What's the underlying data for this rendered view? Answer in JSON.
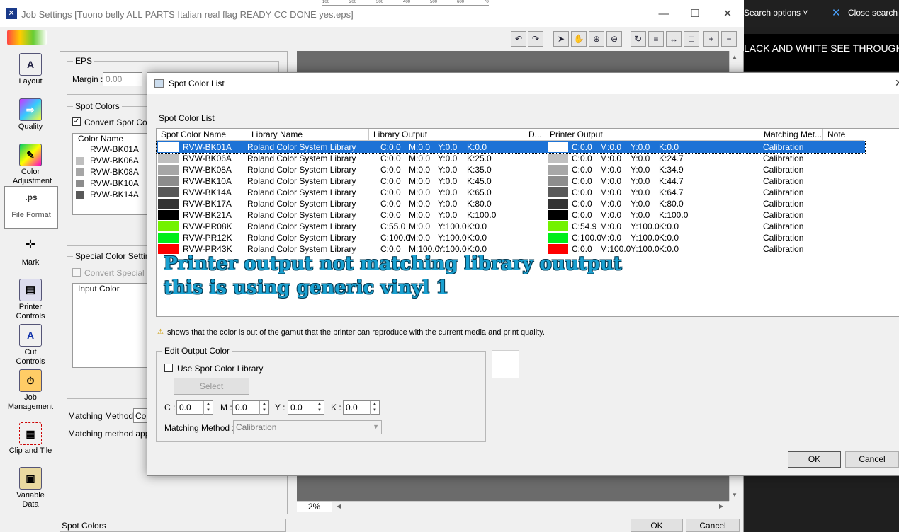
{
  "search": {
    "options_label": "Search options",
    "close_label": "Close search",
    "behind_text": "LACK AND WHITE SEE THROUGH"
  },
  "window": {
    "title": "Job Settings [Tuono belly  ALL PARTS Italian real flag READY CC DONE yes.eps]"
  },
  "ruler": [
    "100",
    "200",
    "300",
    "400",
    "500",
    "600",
    "700"
  ],
  "sidebar": {
    "items": [
      {
        "label": "Layout",
        "icon": "layout-icon"
      },
      {
        "label": "Quality",
        "icon": "quality-icon"
      },
      {
        "label": "Color Adjustment",
        "icon": "color-adjustment-icon"
      },
      {
        "label": "File Format",
        "icon": "file-format-icon",
        "selected": true
      },
      {
        "label": "Mark",
        "icon": "mark-icon"
      },
      {
        "label": "Printer Controls",
        "icon": "printer-controls-icon"
      },
      {
        "label": "Cut Controls",
        "icon": "cut-controls-icon"
      },
      {
        "label": "Job Management",
        "icon": "job-management-icon"
      },
      {
        "label": "Clip and Tile",
        "icon": "clip-and-tile-icon"
      },
      {
        "label": "Variable Data",
        "icon": "variable-data-icon"
      }
    ]
  },
  "panel": {
    "eps_label": "EPS",
    "margin_label": "Margin :",
    "margin_value": "0.00",
    "spot_colors_group": "Spot Colors",
    "convert_spot_label": "Convert Spot Color",
    "color_name_header": "Color Name",
    "mini_list": [
      "RVW-BK01A",
      "RVW-BK06A",
      "RVW-BK08A",
      "RVW-BK10A",
      "RVW-BK14A"
    ],
    "special_group": "Special Color Settings",
    "convert_special_label": "Convert Special Co",
    "input_color_header": "Input Color",
    "matching_method_label": "Matching Method",
    "matching_method_value": "Col",
    "matching_applies": "Matching method applie",
    "footer_tab": "Spot Colors",
    "ok": "OK",
    "cancel": "Cancel",
    "zoom": "2%"
  },
  "dialog": {
    "title": "Spot Color List",
    "list_label": "Spot Color List",
    "columns": [
      "Spot Color Name",
      "Library Name",
      "Library Output",
      "D...",
      "Printer Output",
      "Matching Met...",
      "Note"
    ],
    "rows": [
      {
        "name": "RVW-BK01A",
        "library": "Roland Color System Library",
        "lib_c": "C:0.0",
        "lib_m": "M:0.0",
        "lib_y": "Y:0.0",
        "lib_k": "K:0.0",
        "lib_color": "#ffffff",
        "pr_c": "C:0.0",
        "pr_m": "M:0.0",
        "pr_y": "Y:0.0",
        "pr_k": "K:0.0",
        "pr_color": "#ffffff",
        "method": "Calibration"
      },
      {
        "name": "RVW-BK06A",
        "library": "Roland Color System Library",
        "lib_c": "C:0.0",
        "lib_m": "M:0.0",
        "lib_y": "Y:0.0",
        "lib_k": "K:25.0",
        "lib_color": "#bfbfbf",
        "pr_c": "C:0.0",
        "pr_m": "M:0.0",
        "pr_y": "Y:0.0",
        "pr_k": "K:24.7",
        "pr_color": "#c0c0c0",
        "method": "Calibration"
      },
      {
        "name": "RVW-BK08A",
        "library": "Roland Color System Library",
        "lib_c": "C:0.0",
        "lib_m": "M:0.0",
        "lib_y": "Y:0.0",
        "lib_k": "K:35.0",
        "lib_color": "#a6a6a6",
        "pr_c": "C:0.0",
        "pr_m": "M:0.0",
        "pr_y": "Y:0.0",
        "pr_k": "K:34.9",
        "pr_color": "#a7a7a7",
        "method": "Calibration"
      },
      {
        "name": "RVW-BK10A",
        "library": "Roland Color System Library",
        "lib_c": "C:0.0",
        "lib_m": "M:0.0",
        "lib_y": "Y:0.0",
        "lib_k": "K:45.0",
        "lib_color": "#8c8c8c",
        "pr_c": "C:0.0",
        "pr_m": "M:0.0",
        "pr_y": "Y:0.0",
        "pr_k": "K:44.7",
        "pr_color": "#8d8d8d",
        "method": "Calibration"
      },
      {
        "name": "RVW-BK14A",
        "library": "Roland Color System Library",
        "lib_c": "C:0.0",
        "lib_m": "M:0.0",
        "lib_y": "Y:0.0",
        "lib_k": "K:65.0",
        "lib_color": "#595959",
        "pr_c": "C:0.0",
        "pr_m": "M:0.0",
        "pr_y": "Y:0.0",
        "pr_k": "K:64.7",
        "pr_color": "#5a5a5a",
        "method": "Calibration"
      },
      {
        "name": "RVW-BK17A",
        "library": "Roland Color System Library",
        "lib_c": "C:0.0",
        "lib_m": "M:0.0",
        "lib_y": "Y:0.0",
        "lib_k": "K:80.0",
        "lib_color": "#333333",
        "pr_c": "C:0.0",
        "pr_m": "M:0.0",
        "pr_y": "Y:0.0",
        "pr_k": "K:80.0",
        "pr_color": "#333333",
        "method": "Calibration"
      },
      {
        "name": "RVW-BK21A",
        "library": "Roland Color System Library",
        "lib_c": "C:0.0",
        "lib_m": "M:0.0",
        "lib_y": "Y:0.0",
        "lib_k": "K:100.0",
        "lib_color": "#000000",
        "pr_c": "C:0.0",
        "pr_m": "M:0.0",
        "pr_y": "Y:0.0",
        "pr_k": "K:100.0",
        "pr_color": "#000000",
        "method": "Calibration"
      },
      {
        "name": "RVW-PR08K",
        "library": "Roland Color System Library",
        "lib_c": "C:55.0",
        "lib_m": "M:0.0",
        "lib_y": "Y:100.0",
        "lib_k": "K:0.0",
        "lib_color": "#73f200",
        "pr_c": "C:54.9",
        "pr_m": "M:0.0",
        "pr_y": "Y:100.0",
        "pr_k": "K:0.0",
        "pr_color": "#73f200",
        "method": "Calibration"
      },
      {
        "name": "RVW-PR12K",
        "library": "Roland Color System Library",
        "lib_c": "C:100.0",
        "lib_m": "M:0.0",
        "lib_y": "Y:100.0",
        "lib_k": "K:0.0",
        "lib_color": "#00ee1a",
        "pr_c": "C:100.0",
        "pr_m": "M:0.0",
        "pr_y": "Y:100.0",
        "pr_k": "K:0.0",
        "pr_color": "#00ee1a",
        "method": "Calibration"
      },
      {
        "name": "RVW-PR43K",
        "library": "Roland Color System Library",
        "lib_c": "C:0.0",
        "lib_m": "M:100.0",
        "lib_y": "Y:100.0",
        "lib_k": "K:0.0",
        "lib_color": "#ff0000",
        "pr_c": "C:0.0",
        "pr_m": "M:100.0",
        "pr_y": "Y:100.0",
        "pr_k": "K:0.0",
        "pr_color": "#ff0000",
        "method": "Calibration"
      }
    ],
    "annotation_line1": "Printer output not matching library ouutput",
    "annotation_line2": "this is using generic vinyl 1",
    "gamut_note": "shows that the color is out of the gamut that the printer can reproduce with the current media and print quality.",
    "edit_group": "Edit Output Color",
    "use_library_label": "Use Spot Color Library",
    "select_button": "Select",
    "c_label": "C :",
    "c_value": "0.0",
    "m_label": "M :",
    "m_value": "0.0",
    "y_label": "Y :",
    "y_value": "0.0",
    "k_label": "K :",
    "k_value": "0.0",
    "matching_method_label": "Matching Method :",
    "matching_method_value": "Calibration",
    "ok": "OK",
    "cancel": "Cancel"
  },
  "colors": {
    "selection": "#1c72d6",
    "annotation": "#1aa0d0"
  }
}
